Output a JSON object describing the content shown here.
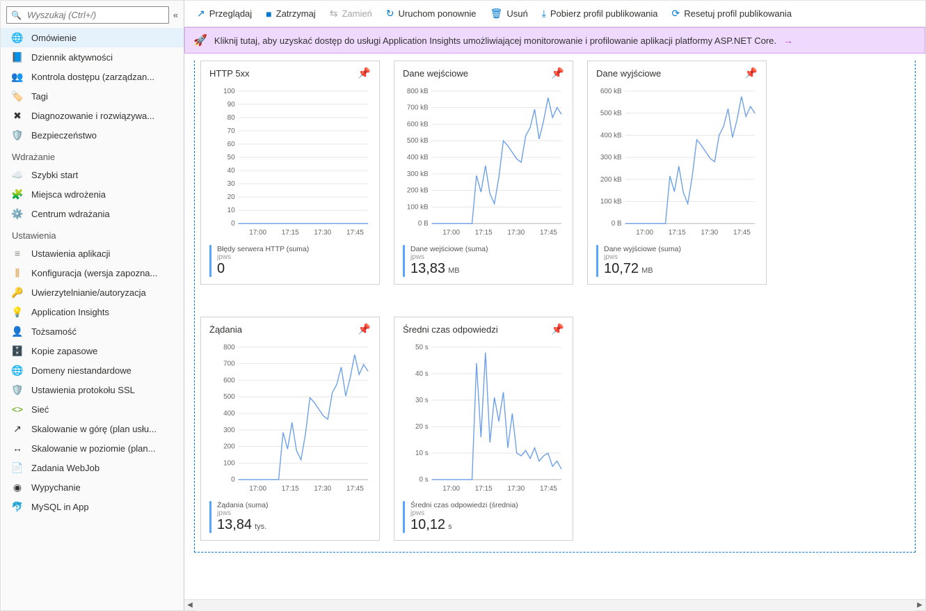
{
  "search": {
    "placeholder": "Wyszukaj (Ctrl+/)"
  },
  "sidebar": {
    "groups": [
      {
        "label": "",
        "items": [
          {
            "icon": "🌐",
            "color": "#0f6cbf",
            "label": "Omówienie",
            "selected": true
          },
          {
            "icon": "📘",
            "color": "#0f6cbf",
            "label": "Dziennik aktywności"
          },
          {
            "icon": "👥",
            "color": "#0f6cbf",
            "label": "Kontrola dostępu (zarządzan..."
          },
          {
            "icon": "🏷️",
            "color": "#7b2fbf",
            "label": "Tagi"
          },
          {
            "icon": "✖",
            "color": "#333",
            "label": "Diagnozowanie i rozwiązywa..."
          },
          {
            "icon": "🛡️",
            "color": "#57a300",
            "label": "Bezpieczeństwo"
          }
        ]
      },
      {
        "label": "Wdrażanie",
        "items": [
          {
            "icon": "☁️",
            "color": "#0f6cbf",
            "label": "Szybki start"
          },
          {
            "icon": "🧩",
            "color": "#0f6cbf",
            "label": "Miejsca wdrożenia"
          },
          {
            "icon": "⚙️",
            "color": "#0f6cbf",
            "label": "Centrum wdrażania"
          }
        ]
      },
      {
        "label": "Ustawienia",
        "items": [
          {
            "icon": "≡",
            "color": "#8a8886",
            "label": "Ustawienia aplikacji"
          },
          {
            "icon": "⫼",
            "color": "#d28a1a",
            "label": "Konfiguracja (wersja zapozna..."
          },
          {
            "icon": "🔑",
            "color": "#e6b800",
            "label": "Uwierzytelnianie/autoryzacja"
          },
          {
            "icon": "💡",
            "color": "#7b2fbf",
            "label": "Application Insights"
          },
          {
            "icon": "👤",
            "color": "#333",
            "label": "Tożsamość"
          },
          {
            "icon": "🗄️",
            "color": "#0f6cbf",
            "label": "Kopie zapasowe"
          },
          {
            "icon": "🌐",
            "color": "#0f6cbf",
            "label": "Domeny niestandardowe"
          },
          {
            "icon": "🛡️",
            "color": "#57a300",
            "label": "Ustawienia protokołu SSL"
          },
          {
            "icon": "<>",
            "color": "#57a300",
            "label": "Sieć"
          },
          {
            "icon": "↗",
            "color": "#333",
            "label": "Skalowanie w górę (plan usłu..."
          },
          {
            "icon": "↔",
            "color": "#333",
            "label": "Skalowanie w poziomie (plan..."
          },
          {
            "icon": "📄",
            "color": "#8a8886",
            "label": "Zadania WebJob"
          },
          {
            "icon": "◉",
            "color": "#333",
            "label": "Wypychanie"
          },
          {
            "icon": "🐬",
            "color": "#00758f",
            "label": "MySQL in App"
          }
        ]
      }
    ]
  },
  "commands": [
    {
      "icon": "↗",
      "label": "Przeglądaj"
    },
    {
      "icon": "■",
      "label": "Zatrzymaj"
    },
    {
      "icon": "⇆",
      "label": "Zamień",
      "disabled": true
    },
    {
      "icon": "↻",
      "label": "Uruchom ponownie"
    },
    {
      "icon": "🗑",
      "label": "Usuń"
    },
    {
      "icon": "⤓",
      "label": "Pobierz profil publikowania"
    },
    {
      "icon": "⟳",
      "label": "Resetuj profil publikowania"
    }
  ],
  "banner": {
    "text": "Kliknij tutaj, aby uzyskać dostęp do usługi Application Insights umożliwiającej monitorowanie i profilowanie aplikacji platformy ASP.NET Core."
  },
  "x_ticks": [
    "17:00",
    "17:15",
    "17:30",
    "17:45"
  ],
  "cards": [
    {
      "title": "HTTP 5xx",
      "metric_name": "Błędy serwera HTTP (suma)",
      "metric_sub": "jpws",
      "metric_val": "0",
      "metric_unit": ""
    },
    {
      "title": "Dane wejściowe",
      "metric_name": "Dane wejściowe (suma)",
      "metric_sub": "jpws",
      "metric_val": "13,83",
      "metric_unit": "MB"
    },
    {
      "title": "Dane wyjściowe",
      "metric_name": "Dane wyjściowe (suma)",
      "metric_sub": "jpws",
      "metric_val": "10,72",
      "metric_unit": "MB"
    },
    {
      "title": "Żądania",
      "metric_name": "Żądania (suma)",
      "metric_sub": "jpws",
      "metric_val": "13,84",
      "metric_unit": "tys."
    },
    {
      "title": "Średni czas odpowiedzi",
      "metric_name": "Średni czas odpowiedzi (średnia)",
      "metric_sub": "jpws",
      "metric_val": "10,12",
      "metric_unit": "s"
    }
  ],
  "chart_data": [
    {
      "type": "line",
      "title": "HTTP 5xx",
      "xlabel": "",
      "ylabel": "",
      "ylim": [
        0,
        100
      ],
      "y_ticks": [
        0,
        10,
        20,
        30,
        40,
        50,
        60,
        70,
        80,
        90,
        100
      ],
      "y_tick_labels": [
        "0",
        "10",
        "20",
        "30",
        "40",
        "50",
        "60",
        "70",
        "80",
        "90",
        "100"
      ],
      "x_categories": [
        "17:00",
        "17:15",
        "17:30",
        "17:45"
      ],
      "series": [
        {
          "name": "Błędy serwera HTTP (suma)",
          "values": [
            0,
            0,
            0,
            0,
            0,
            0,
            0,
            0,
            0,
            0,
            0,
            0,
            0,
            0,
            0,
            0,
            0,
            0,
            0,
            0,
            0,
            0,
            0,
            0,
            0,
            0,
            0,
            0,
            0,
            0
          ]
        }
      ]
    },
    {
      "type": "line",
      "title": "Dane wejściowe",
      "xlabel": "",
      "ylabel": "",
      "ylim": [
        0,
        800
      ],
      "y_ticks": [
        0,
        100,
        200,
        300,
        400,
        500,
        600,
        700,
        800
      ],
      "y_tick_labels": [
        "0 B",
        "100 kB",
        "200 kB",
        "300 kB",
        "400 kB",
        "500 kB",
        "600 kB",
        "700 kB",
        "800 kB"
      ],
      "x_categories": [
        "17:00",
        "17:15",
        "17:30",
        "17:45"
      ],
      "series": [
        {
          "name": "Dane wejściowe (suma)",
          "values": [
            0,
            0,
            0,
            0,
            0,
            0,
            0,
            0,
            0,
            0,
            290,
            190,
            350,
            180,
            120,
            280,
            500,
            470,
            430,
            390,
            370,
            530,
            580,
            690,
            510,
            620,
            760,
            640,
            700,
            660
          ]
        }
      ]
    },
    {
      "type": "line",
      "title": "Dane wyjściowe",
      "xlabel": "",
      "ylabel": "",
      "ylim": [
        0,
        600
      ],
      "y_ticks": [
        0,
        100,
        200,
        300,
        400,
        500,
        600
      ],
      "y_tick_labels": [
        "0 B",
        "100 kB",
        "200 kB",
        "300 kB",
        "400 kB",
        "500 kB",
        "600 kB"
      ],
      "x_categories": [
        "17:00",
        "17:15",
        "17:30",
        "17:45"
      ],
      "series": [
        {
          "name": "Dane wyjściowe (suma)",
          "values": [
            0,
            0,
            0,
            0,
            0,
            0,
            0,
            0,
            0,
            0,
            215,
            145,
            260,
            140,
            90,
            215,
            380,
            355,
            325,
            295,
            280,
            400,
            440,
            520,
            390,
            470,
            575,
            485,
            530,
            500
          ]
        }
      ]
    },
    {
      "type": "line",
      "title": "Żądania",
      "xlabel": "",
      "ylabel": "",
      "ylim": [
        0,
        800
      ],
      "y_ticks": [
        0,
        100,
        200,
        300,
        400,
        500,
        600,
        700,
        800
      ],
      "y_tick_labels": [
        "0",
        "100",
        "200",
        "300",
        "400",
        "500",
        "600",
        "700",
        "800"
      ],
      "x_categories": [
        "17:00",
        "17:15",
        "17:30",
        "17:45"
      ],
      "series": [
        {
          "name": "Żądania (suma)",
          "values": [
            0,
            0,
            0,
            0,
            0,
            0,
            0,
            0,
            0,
            0,
            285,
            185,
            345,
            175,
            120,
            275,
            495,
            465,
            425,
            385,
            365,
            525,
            575,
            680,
            505,
            615,
            755,
            635,
            695,
            655
          ]
        }
      ]
    },
    {
      "type": "line",
      "title": "Średni czas odpowiedzi",
      "xlabel": "",
      "ylabel": "",
      "ylim": [
        0,
        50
      ],
      "y_ticks": [
        0,
        10,
        20,
        30,
        40,
        50
      ],
      "y_tick_labels": [
        "0 s",
        "10 s",
        "20 s",
        "30 s",
        "40 s",
        "50 s"
      ],
      "x_categories": [
        "17:00",
        "17:15",
        "17:30",
        "17:45"
      ],
      "series": [
        {
          "name": "Średni czas odpowiedzi (średnia)",
          "values": [
            0,
            0,
            0,
            0,
            0,
            0,
            0,
            0,
            0,
            0,
            44,
            16,
            48,
            14,
            31,
            22,
            33,
            12,
            25,
            10,
            9,
            11,
            8,
            12,
            7,
            9,
            10,
            5,
            7,
            4
          ]
        }
      ]
    }
  ]
}
